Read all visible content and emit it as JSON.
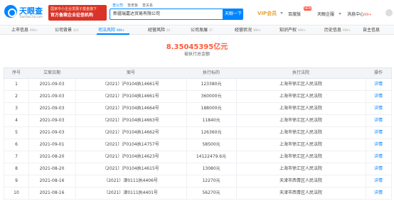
{
  "header": {
    "logo_text": "天眼查",
    "logo_sub": "TianYanCha.com",
    "banner_line1": "国家中小企业发展子基金旗下",
    "banner_line2": "官方备案企业征信机构",
    "search_tabs": [
      "查公司",
      "查老板",
      "查关系"
    ],
    "search_value": "新疆瑞嘉达贸易有限公司",
    "search_button": "天眼一下",
    "vip_label": "VIP会员",
    "nav": [
      "百度版",
      "天眼企服",
      "消息中心"
    ],
    "nav_badge": "NEW",
    "message_count": "99+"
  },
  "tabs": [
    {
      "label": "上市信息",
      "count": "999+"
    },
    {
      "label": "公司背景",
      "count": "425"
    },
    {
      "label": "司法风险",
      "count": "999+"
    },
    {
      "label": "经营风险",
      "count": "20"
    },
    {
      "label": "公司发展",
      "count": "27"
    },
    {
      "label": "经营状况",
      "count": "999+"
    },
    {
      "label": "知识产权",
      "count": "999+"
    },
    {
      "label": "历史信息",
      "count": "999+"
    },
    {
      "label": "自主信息",
      "count": ""
    }
  ],
  "active_tab": "司法风险",
  "summary": {
    "total": "8.35045395亿元",
    "label": "被执行总金额"
  },
  "table": {
    "headers": [
      "序号",
      "立案日期",
      "案号",
      "执行标的",
      "执行法院",
      "操作"
    ],
    "rows": [
      [
        "1",
        "2021-09-03",
        "（2021）沪0104执14661号",
        "123380元",
        "上海市徐汇区人民法院",
        "详情"
      ],
      [
        "2",
        "2021-09-03",
        "（2021）沪0104执14661号",
        "360000元",
        "上海市徐汇区人民法院",
        "详情"
      ],
      [
        "3",
        "2021-09-03",
        "（2021）沪0104执14664号",
        "188000元",
        "上海市徐汇区人民法院",
        "详情"
      ],
      [
        "4",
        "2021-09-03",
        "（2021）沪0104执14663号",
        "11840元",
        "上海市徐汇区人民法院",
        "详情"
      ],
      [
        "5",
        "2021-09-03",
        "（2021）沪0104执14662号",
        "126360元",
        "上海市徐汇区人民法院",
        "详情"
      ],
      [
        "6",
        "2021-09-01",
        "（2021）沪0104执14757号",
        "58500元",
        "上海市徐汇区人民法院",
        "详情"
      ],
      [
        "7",
        "2021-08-20",
        "（2021）沪0104执14623号",
        "14122479.6元",
        "上海市徐汇区人民法院",
        "详情"
      ],
      [
        "8",
        "2021-08-20",
        "（2021）沪0104执14615号",
        "13080元",
        "上海市徐汇区人民法院",
        "详情"
      ],
      [
        "9",
        "2021-08-16",
        "（2021）津0111执4406号",
        "12270元",
        "天津市西青区人民法院",
        "详情"
      ],
      [
        "10",
        "2021-08-16",
        "（2021）津0111执4401号",
        "56270元",
        "天津市西青区人民法院",
        "详情"
      ]
    ]
  },
  "colors": {
    "brand": "#0084ff",
    "amount": "#ff5a36",
    "banner": "#d9332a",
    "vip": "#e2a33a"
  }
}
